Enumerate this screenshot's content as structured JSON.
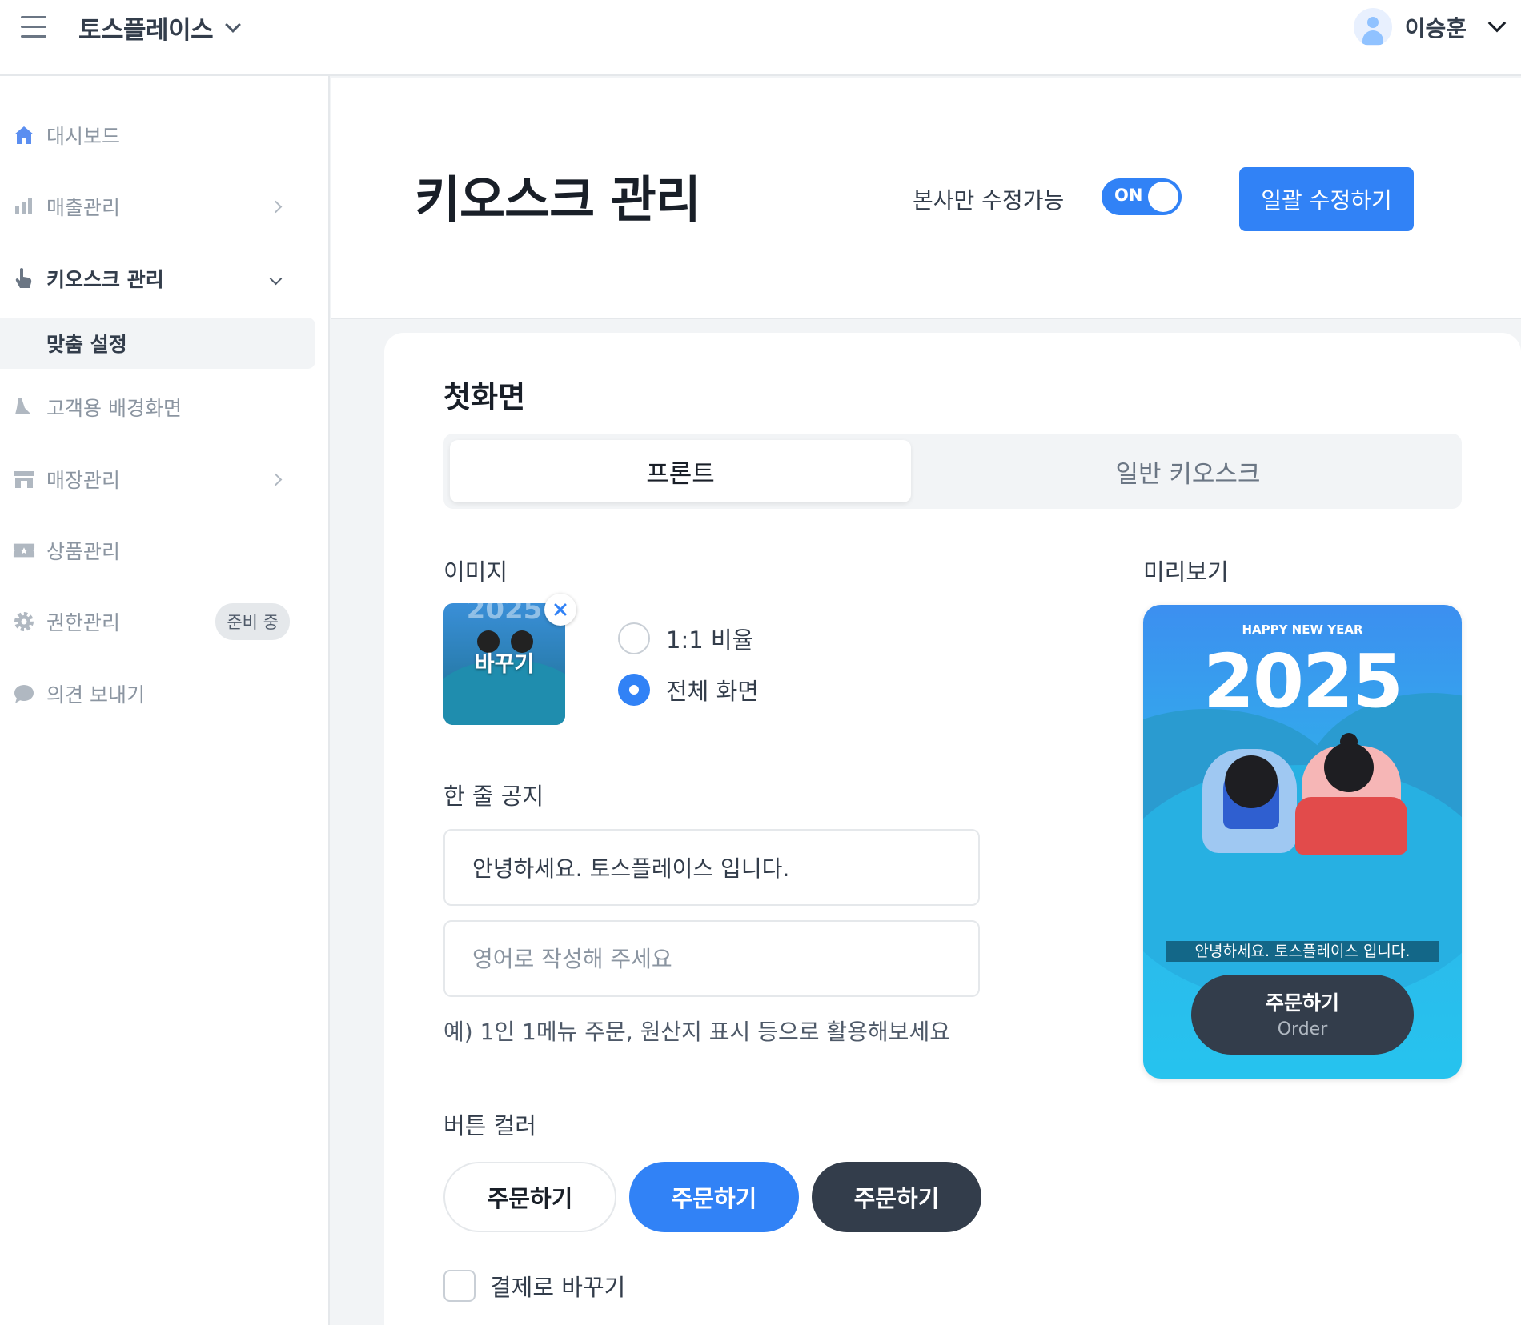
{
  "topbar": {
    "workspace_name": "토스플레이스",
    "user_name": "이승훈"
  },
  "sidebar": {
    "items": [
      {
        "label": "대시보드",
        "icon": "home-icon"
      },
      {
        "label": "매출관리",
        "icon": "bar-chart-icon"
      },
      {
        "label": "키오스크 관리",
        "icon": "hand-pointer-icon"
      },
      {
        "label": "맞춤 설정"
      },
      {
        "label": "고객용 배경화면",
        "icon": "brush-icon"
      },
      {
        "label": "매장관리",
        "icon": "store-icon"
      },
      {
        "label": "상품관리",
        "icon": "ticket-icon"
      },
      {
        "label": "권한관리",
        "icon": "gear-icon",
        "badge": "준비 중"
      },
      {
        "label": "의견 보내기",
        "icon": "chat-bubble-icon"
      }
    ]
  },
  "header": {
    "title": "키오스크 관리",
    "permission_label": "본사만 수정가능",
    "toggle_text": "ON",
    "bulk_edit_label": "일괄 수정하기"
  },
  "main": {
    "section_title": "첫화면",
    "tabs": [
      {
        "label": "프론트",
        "active": true
      },
      {
        "label": "일반 키오스크",
        "active": false
      }
    ],
    "image_label": "이미지",
    "thumbnail_change_label": "바꾸기",
    "thumbnail_year": "2025",
    "ratio_options": [
      {
        "label": "1:1 비율",
        "selected": false
      },
      {
        "label": "전체 화면",
        "selected": true
      }
    ],
    "notice_label": "한 줄 공지",
    "notice_value": "안녕하세요. 토스플레이스 입니다.",
    "english_placeholder": "영어로 작성해 주세요",
    "notice_hint": "예) 1인 1메뉴 주문, 원산지 표시 등으로 활용해보세요",
    "button_color_label": "버튼 컬러",
    "button_color_options": [
      {
        "label": "주문하기",
        "style": "white",
        "color": "#ffffff"
      },
      {
        "label": "주문하기",
        "style": "blue",
        "color": "#3182f6"
      },
      {
        "label": "주문하기",
        "style": "dark",
        "color": "#333d4b"
      }
    ],
    "checkbox_label": "결제로 바꾸기",
    "checkbox_checked": false
  },
  "preview": {
    "label": "미리보기",
    "subtitle": "HAPPY NEW YEAR",
    "year": "2025",
    "notice": "안녕하세요. 토스플레이스 입니다.",
    "order_ko": "주문하기",
    "order_en": "Order"
  },
  "colors": {
    "accent": "#3182f6",
    "dark_button": "#333d4b"
  }
}
